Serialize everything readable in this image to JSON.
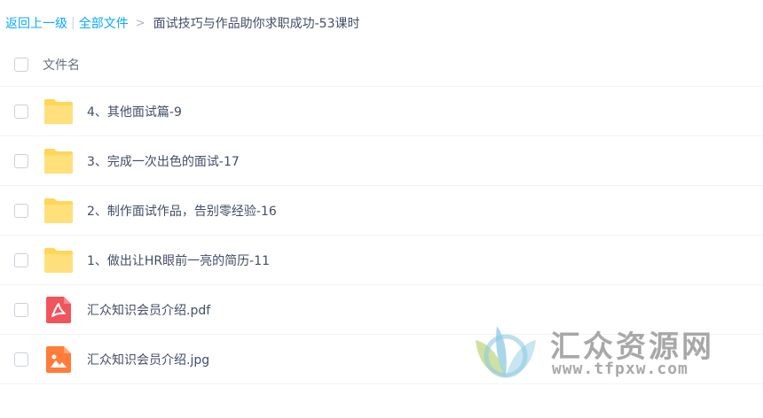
{
  "breadcrumb": {
    "back": "返回上一级",
    "separator": "|",
    "all_files": "全部文件",
    "chevron": ">",
    "current": "面试技巧与作品助你求职成功-53课时"
  },
  "list": {
    "header_label": "文件名",
    "items": [
      {
        "name": "4、其他面试篇-9",
        "icon": "folder-icon"
      },
      {
        "name": "3、完成一次出色的面试-17",
        "icon": "folder-icon"
      },
      {
        "name": "2、制作面试作品，告别零经验-16",
        "icon": "folder-icon"
      },
      {
        "name": "1、做出让HR眼前一亮的简历-11",
        "icon": "folder-icon"
      },
      {
        "name": "汇众知识会员介绍.pdf",
        "icon": "pdf-icon"
      },
      {
        "name": "汇众知识会员介绍.jpg",
        "icon": "image-icon"
      }
    ]
  },
  "watermark": {
    "title": "汇众资源网",
    "url": "www.tfpxw.com"
  },
  "colors": {
    "link": "#09aaff",
    "folder": "#ffd659",
    "pdf": "#f2545b",
    "image": "#ff7c3a"
  }
}
